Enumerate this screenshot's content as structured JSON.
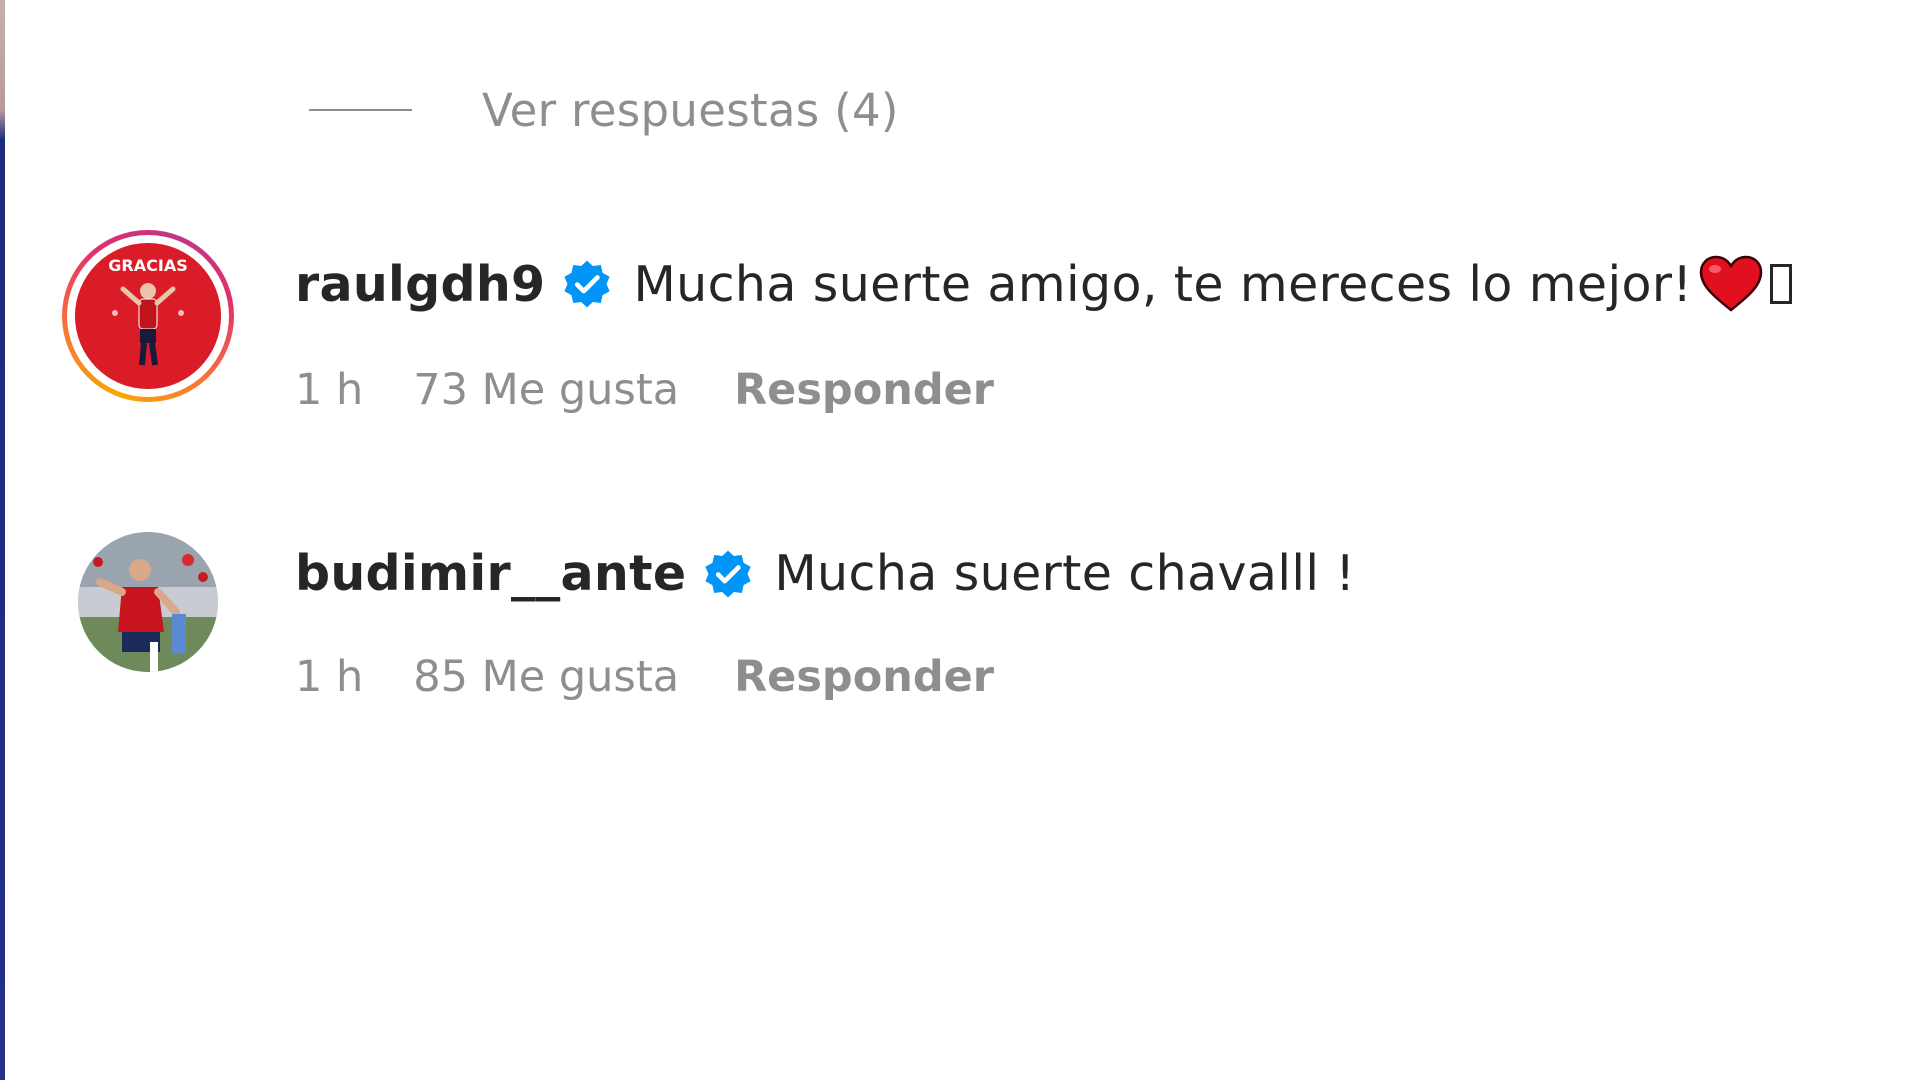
{
  "replies_toggle": {
    "label": "Ver respuestas (4)"
  },
  "comments": [
    {
      "username": "raulgdh9",
      "verified": true,
      "text": "Mucha suerte amigo, te mereces lo mejor!",
      "emoji": "red-heart",
      "time": "1 h",
      "likes": "73 Me gusta",
      "reply": "Responder",
      "has_story_ring": true
    },
    {
      "username": "budimir__ante",
      "verified": true,
      "text": "Mucha suerte chavalll !",
      "time": "1 h",
      "likes": "85 Me gusta",
      "reply": "Responder",
      "has_story_ring": false
    }
  ],
  "colors": {
    "text": "#262626",
    "secondary": "#8e8e8e",
    "verified_blue": "#0095f6"
  }
}
